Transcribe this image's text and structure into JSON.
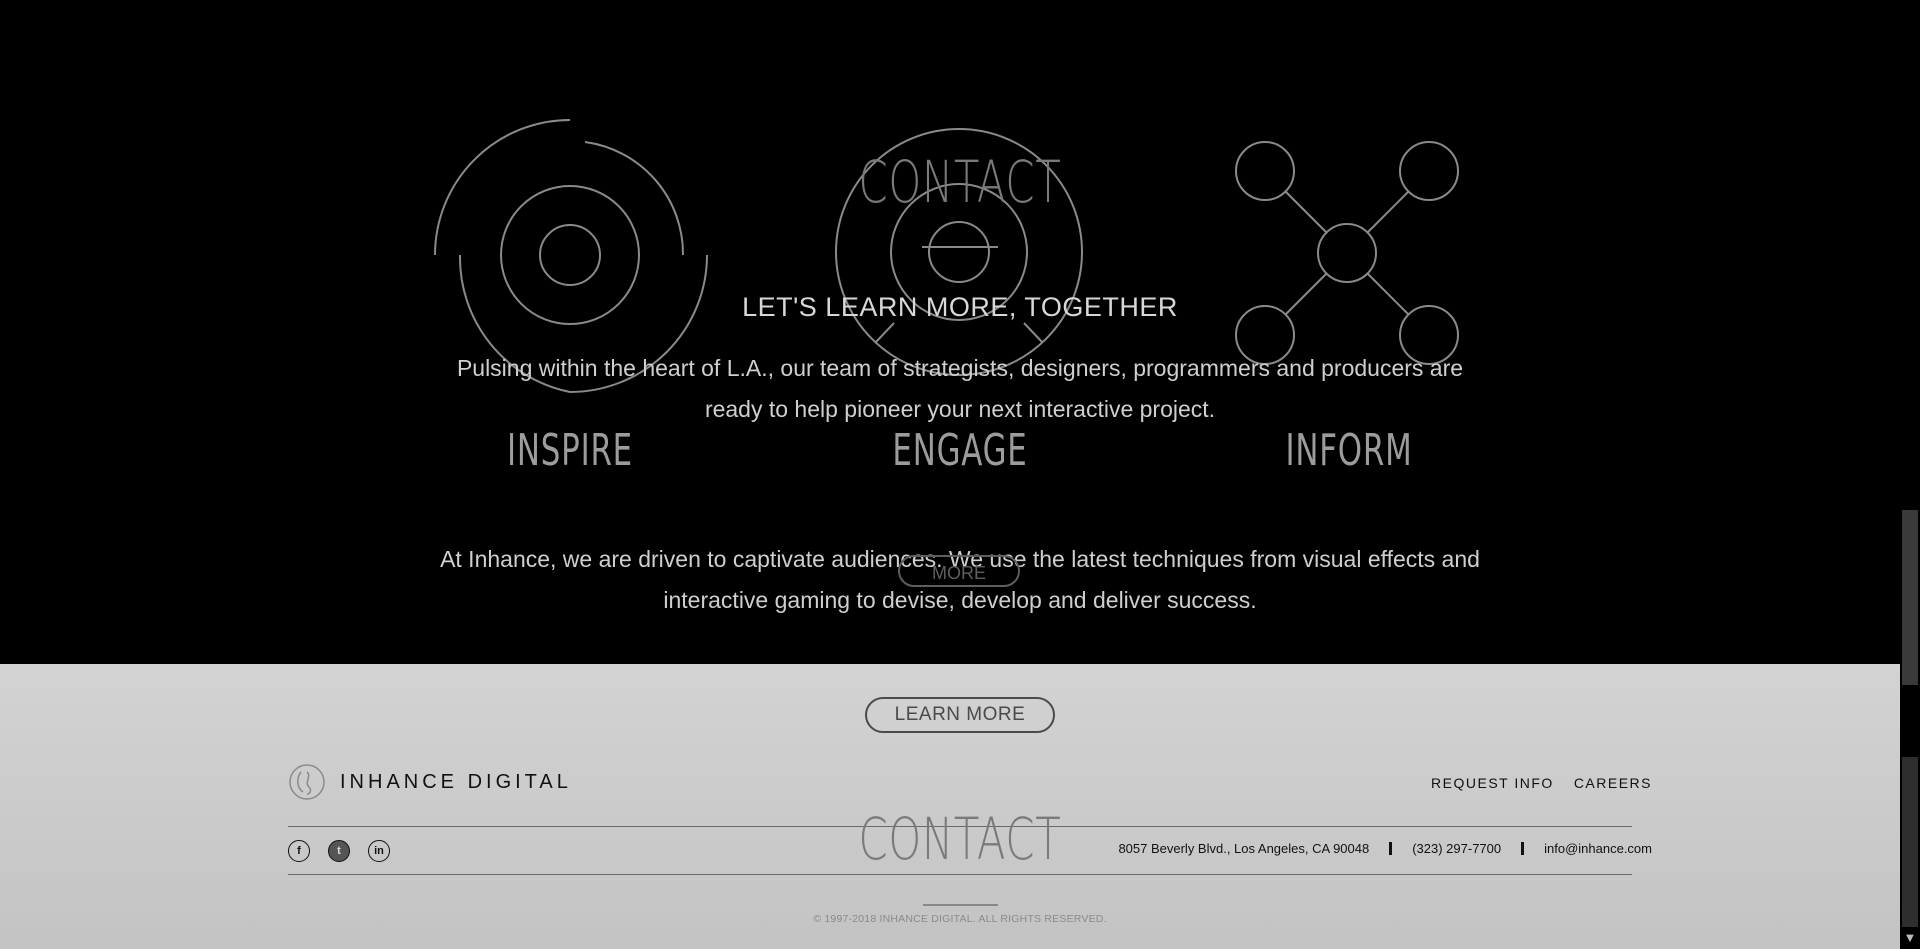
{
  "features": [
    {
      "label": "INSPIRE",
      "icon": "concentric-rings-icon"
    },
    {
      "label": "ENGAGE",
      "icon": "target-icon"
    },
    {
      "label": "INFORM",
      "icon": "network-nodes-icon"
    }
  ],
  "contact_overlay": {
    "title": "CONTACT",
    "subtitle": "LET'S LEARN MORE, TOGETHER",
    "body": "Pulsing within the heart of L.A., our team of strategists, designers, programmers and producers are ready to help pioneer your next interactive project."
  },
  "about": {
    "body": "At Inhance, we are driven to captivate audiences. We use the latest techniques from visual effects and interactive gaming to devise, develop and deliver success.",
    "more_label": "MORE"
  },
  "footer": {
    "learn_more_label": "LEARN MORE",
    "brand": "INHANCE DIGITAL",
    "nav": [
      "REQUEST INFO",
      "CAREERS"
    ],
    "contact_title": "CONTACT",
    "address": "8057 Beverly Blvd., Los Angeles, CA 90048",
    "phone": "(323) 297-7700",
    "email": "info@inhance.com",
    "socials": [
      {
        "name": "facebook",
        "glyph": "f"
      },
      {
        "name": "twitter",
        "glyph": "t"
      },
      {
        "name": "linkedin",
        "glyph": "in"
      }
    ],
    "copyright": "© 1997-2018 INHANCE DIGITAL. ALL RIGHTS RESERVED."
  },
  "colors": {
    "background": "#000000",
    "footer_bg": "#c8c8c8",
    "icon_stroke": "#8a8a8a"
  }
}
